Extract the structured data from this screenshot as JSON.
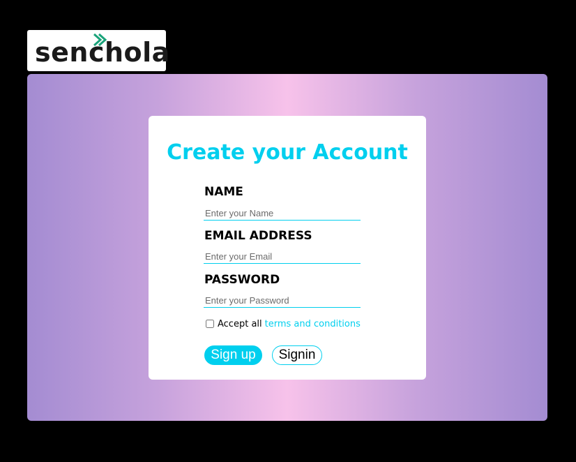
{
  "logo": {
    "text": "senchola",
    "accent_color": "#1aa37a"
  },
  "form": {
    "title": "Create your Account",
    "name_label": "NAME",
    "name_placeholder": "Enter your Name",
    "email_label": "EMAIL ADDRESS",
    "email_placeholder": "Enter your Email",
    "password_label": "PASSWORD",
    "password_placeholder": "Enter your Password",
    "terms_prefix": "Accept all",
    "terms_link": "terms and conditions",
    "terms_checked": false,
    "signup_label": "Sign up",
    "signin_label": "Signin"
  },
  "colors": {
    "accent": "#00cfee",
    "gradient_edge": "#a48cd2",
    "gradient_center": "#f7c2ea"
  }
}
